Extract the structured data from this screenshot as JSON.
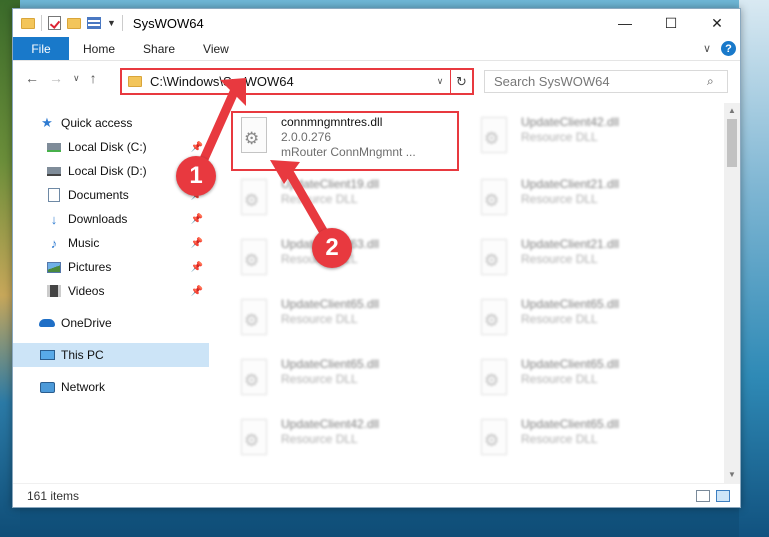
{
  "window": {
    "title": "SysWOW64",
    "controls": {
      "minimize": "—",
      "maximize": "☐",
      "close": "✕"
    }
  },
  "ribbon": {
    "tabs": [
      "File",
      "Home",
      "Share",
      "View"
    ],
    "expand_icon": "chevron-down-icon",
    "help_label": "?"
  },
  "address": {
    "path": "C:\\Windows\\SysWOW64",
    "search_placeholder": "Search SysWOW64"
  },
  "nav_pane": {
    "quick_access": "Quick access",
    "items": [
      {
        "label": "Local Disk (C:)",
        "icon": "drive-icon",
        "pinned": true
      },
      {
        "label": "Local Disk (D:)",
        "icon": "drive-icon",
        "pinned": false
      },
      {
        "label": "Documents",
        "icon": "documents-icon",
        "pinned": true
      },
      {
        "label": "Downloads",
        "icon": "download-icon",
        "pinned": true
      },
      {
        "label": "Music",
        "icon": "music-icon",
        "pinned": true
      },
      {
        "label": "Pictures",
        "icon": "pictures-icon",
        "pinned": true
      },
      {
        "label": "Videos",
        "icon": "videos-icon",
        "pinned": true
      }
    ],
    "onedrive": "OneDrive",
    "this_pc": "This PC",
    "network": "Network"
  },
  "files": [
    {
      "name": "connmngmntres.dll",
      "line2": "2.0.0.276",
      "line3": "mRouter ConnMngmnt ...",
      "highlighted": true
    },
    {
      "name": "UpdateClient42.dll",
      "line2": "Resource DLL"
    },
    {
      "name": "UpdateClient19.dll",
      "line2": "Resource DLL"
    },
    {
      "name": "UpdateClient21.dll",
      "line2": "Resource DLL"
    },
    {
      "name": "UpdateClient63.dll",
      "line2": "Resource DLL"
    },
    {
      "name": "UpdateClient21.dll",
      "line2": "Resource DLL"
    },
    {
      "name": "UpdateClient65.dll",
      "line2": "Resource DLL"
    },
    {
      "name": "UpdateClient65.dll",
      "line2": "Resource DLL"
    },
    {
      "name": "UpdateClient65.dll",
      "line2": "Resource DLL"
    },
    {
      "name": "UpdateClient65.dll",
      "line2": "Resource DLL"
    },
    {
      "name": "UpdateClient42.dll",
      "line2": "Resource DLL"
    },
    {
      "name": "UpdateClient65.dll",
      "line2": "Resource DLL"
    }
  ],
  "status": {
    "item_count": "161 items"
  },
  "annotations": {
    "badge1": "1",
    "badge2": "2",
    "color": "#e8393f"
  }
}
